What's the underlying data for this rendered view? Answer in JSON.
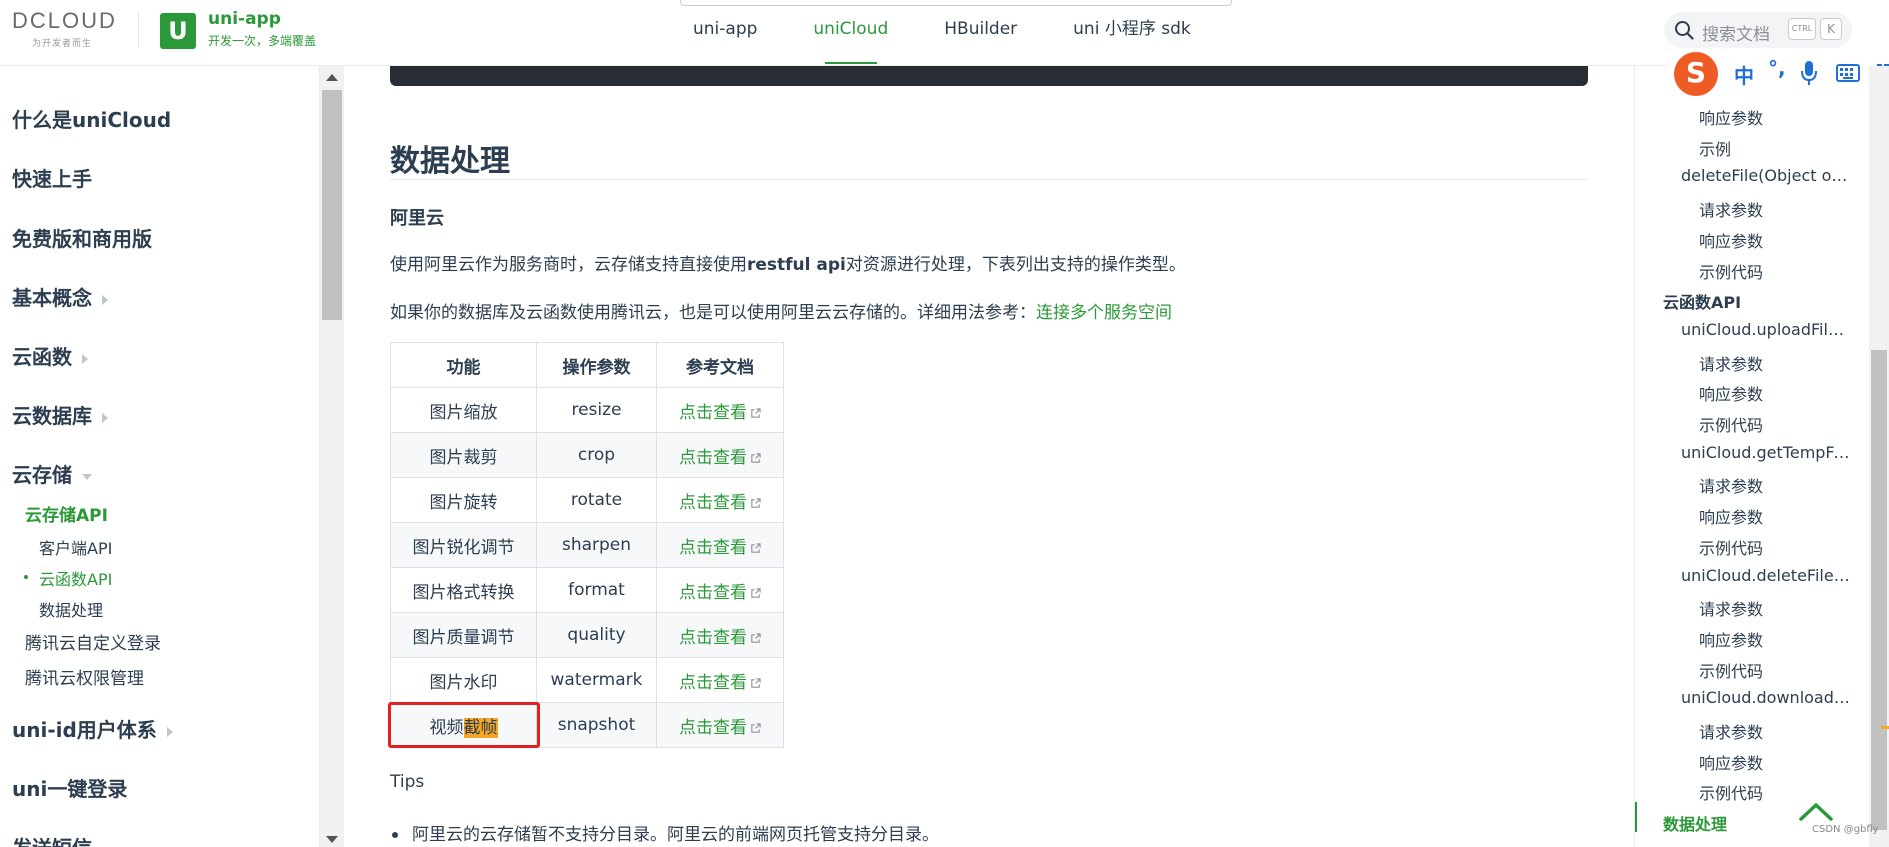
{
  "header": {
    "dcloud_logo": "DCLOUD",
    "dcloud_slogan": "为开发者而生",
    "uni_logo_letter": "U",
    "uni_name": "uni-app",
    "uni_slogan": "开发一次，多端覆盖",
    "nav": [
      {
        "label": "uni-app",
        "active": false
      },
      {
        "label": "uniCloud",
        "active": true
      },
      {
        "label": "HBuilder",
        "active": false
      },
      {
        "label": "uni 小程序 sdk",
        "active": false
      }
    ],
    "search": {
      "placeholder": "搜索文档",
      "key1": "CTRL",
      "key2": "K"
    }
  },
  "ime": {
    "logo": "S",
    "mode": "中",
    "punct": "°,"
  },
  "sidebar": {
    "items": [
      {
        "label": "什么是uniCloud"
      },
      {
        "label": "快速上手"
      },
      {
        "label": "免费版和商用版"
      },
      {
        "label": "基本概念"
      },
      {
        "label": "云函数"
      },
      {
        "label": "云数据库"
      },
      {
        "label": "云存储"
      },
      {
        "label": "uni-id用户体系"
      },
      {
        "label": "uni一键登录"
      },
      {
        "label": "发送短信"
      }
    ],
    "sub": {
      "storage_api": "云存储API",
      "client_api": "客户端API",
      "cloud_api": "云函数API",
      "data_processing": "数据处理",
      "tencent_login": "腾讯云自定义登录",
      "tencent_perm": "腾讯云权限管理"
    }
  },
  "main": {
    "heading": "数据处理",
    "subheading": "阿里云",
    "para1_a": "使用阿里云作为服务商时，云存储支持直接使用",
    "para1_b": "restful api",
    "para1_c": "对资源进行处理，下表列出支持的操作类型。",
    "para2_a": "如果你的数据库及云函数使用腾讯云，也是可以使用阿里云云存储的。详细用法参考：",
    "para2_link": "连接多个服务空间",
    "table": {
      "headers": [
        "功能",
        "操作参数",
        "参考文档"
      ],
      "rows": [
        {
          "feature": "图片缩放",
          "param": "resize",
          "doc": "点击查看"
        },
        {
          "feature": "图片裁剪",
          "param": "crop",
          "doc": "点击查看"
        },
        {
          "feature": "图片旋转",
          "param": "rotate",
          "doc": "点击查看"
        },
        {
          "feature": "图片锐化调节",
          "param": "sharpen",
          "doc": "点击查看"
        },
        {
          "feature": "图片格式转换",
          "param": "format",
          "doc": "点击查看"
        },
        {
          "feature": "图片质量调节",
          "param": "quality",
          "doc": "点击查看"
        },
        {
          "feature": "图片水印",
          "param": "watermark",
          "doc": "点击查看"
        }
      ],
      "last_row": {
        "feature_a": "视频",
        "feature_b": "截帧",
        "param": "snapshot",
        "doc": "点击查看"
      }
    },
    "tips_title": "Tips",
    "tips": [
      "阿里云的云存储暂不支持分目录。阿里云的前端网页托管支持分目录。"
    ]
  },
  "toc": {
    "items": [
      {
        "label": "响应参数",
        "level": 3
      },
      {
        "label": "示例",
        "level": 3
      },
      {
        "label": "deleteFile(Object obje...",
        "level": 2
      },
      {
        "label": "请求参数",
        "level": 3
      },
      {
        "label": "响应参数",
        "level": 3
      },
      {
        "label": "示例代码",
        "level": 3
      },
      {
        "label": "云函数API",
        "level": 1
      },
      {
        "label": "uniCloud.uploadFile(...",
        "level": 2
      },
      {
        "label": "请求参数",
        "level": 3
      },
      {
        "label": "响应参数",
        "level": 3
      },
      {
        "label": "示例代码",
        "level": 3
      },
      {
        "label": "uniCloud.getTempFile...",
        "level": 2
      },
      {
        "label": "请求参数",
        "level": 3
      },
      {
        "label": "响应参数",
        "level": 3
      },
      {
        "label": "示例代码",
        "level": 3
      },
      {
        "label": "uniCloud.deleteFile(O...",
        "level": 2
      },
      {
        "label": "请求参数",
        "level": 3
      },
      {
        "label": "响应参数",
        "level": 3
      },
      {
        "label": "示例代码",
        "level": 3
      },
      {
        "label": "uniCloud.downloadFil...",
        "level": 2
      },
      {
        "label": "请求参数",
        "level": 3
      },
      {
        "label": "响应参数",
        "level": 3
      },
      {
        "label": "示例代码",
        "level": 3
      },
      {
        "label": "数据处理",
        "level": 1
      }
    ]
  },
  "watermark": "CSDN @gbfly"
}
